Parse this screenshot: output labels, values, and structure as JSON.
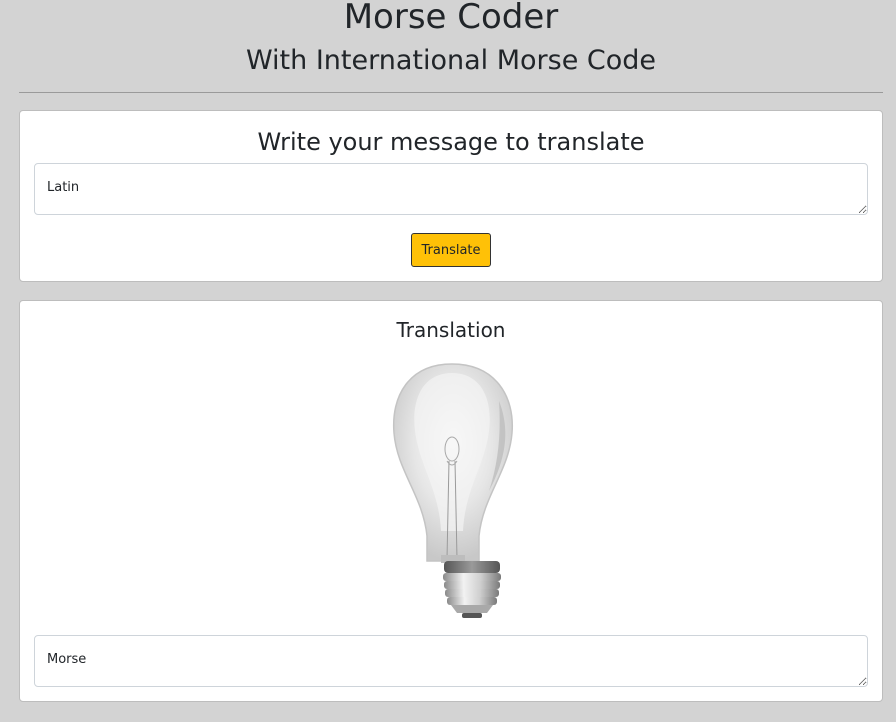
{
  "header": {
    "title": "Morse Coder",
    "subtitle": "With International Morse Code"
  },
  "input_card": {
    "heading": "Write your message to translate",
    "input_placeholder": "Latin",
    "button_label": "Translate"
  },
  "output_card": {
    "heading": "Translation",
    "lamp_icon": "lightbulb-icon",
    "lamp_state": "off",
    "output_placeholder": "Morse"
  },
  "colors": {
    "background": "#d3d3d3",
    "button": "#ffc107"
  }
}
